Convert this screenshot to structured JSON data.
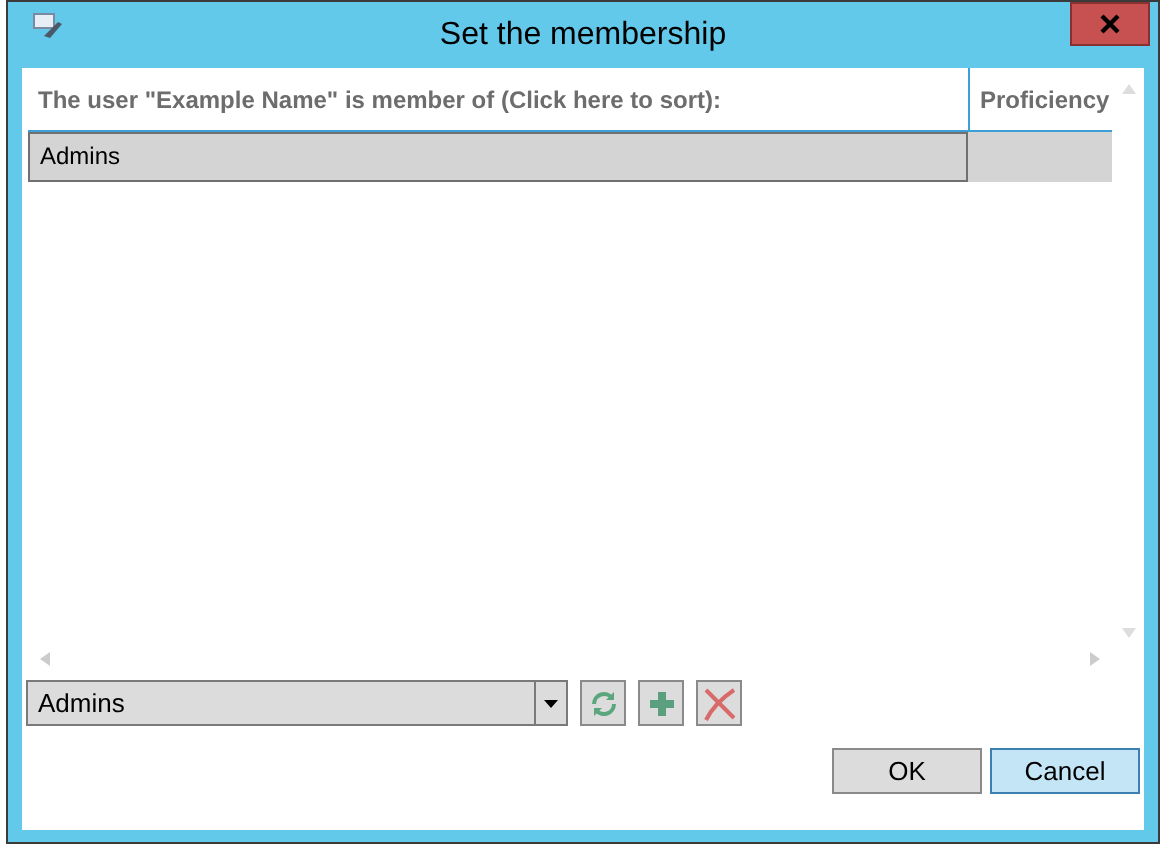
{
  "window": {
    "title": "Set the membership"
  },
  "table": {
    "columns": [
      "The user \"Example Name\" is member of (Click here to sort):",
      "Proficiency"
    ],
    "rows": [
      {
        "cells": [
          "Admins"
        ],
        "selected": true
      }
    ]
  },
  "group_select": {
    "value": "Admins"
  },
  "buttons": [
    {
      "label": "OK",
      "focused": false
    },
    {
      "label": "Cancel",
      "focused": true
    }
  ]
}
